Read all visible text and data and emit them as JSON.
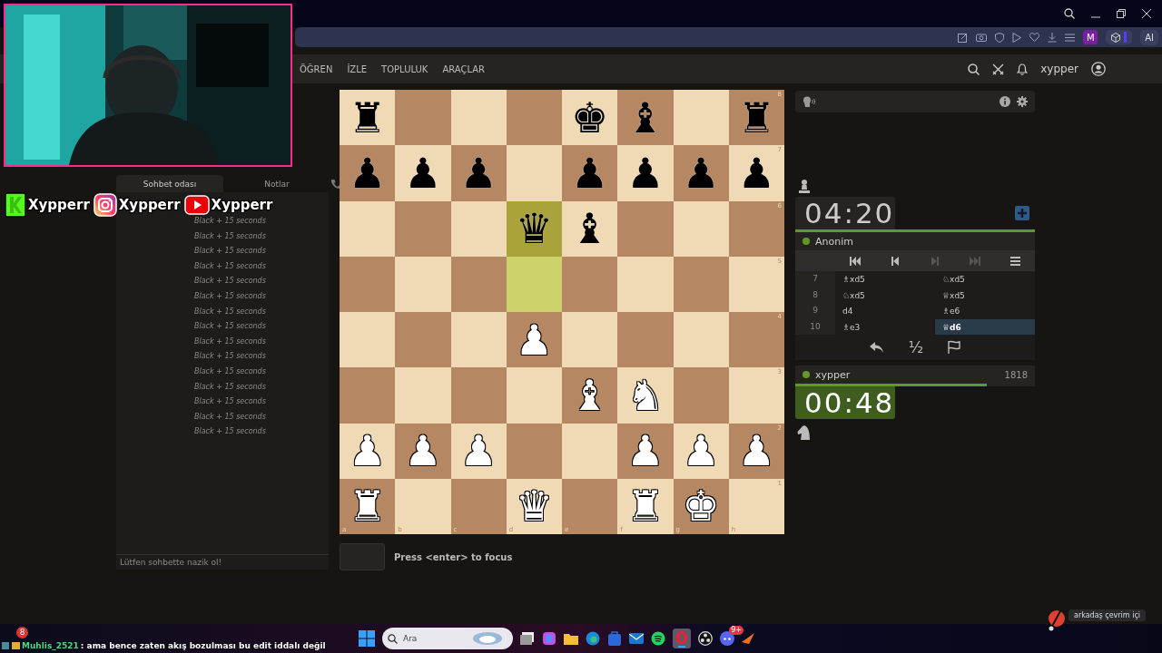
{
  "browser": {
    "profile": "M",
    "ai_button": "AI"
  },
  "site_nav": {
    "items": [
      "ÖĞREN",
      "İZLE",
      "TOPLULUK",
      "ARAÇLAR"
    ],
    "username": "xypper"
  },
  "chat": {
    "tabs": [
      {
        "label": "Sohbet odası",
        "selected": true
      },
      {
        "label": "Notlar",
        "selected": false
      }
    ],
    "messages": [
      "Black + 15 seconds",
      "Black + 15 seconds",
      "Black + 15 seconds",
      "Black + 15 seconds",
      "Black + 15 seconds",
      "Black + 15 seconds",
      "Black + 15 seconds",
      "Black + 15 seconds",
      "Black + 15 seconds",
      "Black + 15 seconds",
      "Black + 15 seconds",
      "Black + 15 seconds",
      "Black + 15 seconds",
      "Black + 15 seconds",
      "Black + 15 seconds"
    ],
    "placeholder": "Lütfen sohbette nazik ol!"
  },
  "stream_overlay": {
    "socials": [
      {
        "kind": "kick",
        "handle": "Xypperr"
      },
      {
        "kind": "instagram",
        "handle": "Xypperr"
      },
      {
        "kind": "youtube",
        "handle": "Xypperr"
      }
    ],
    "chat_line": {
      "badge_count": "8",
      "user": "Muhlis_2521",
      "text": ": ama bence zaten akış bozulması bu edit iddalı değil"
    }
  },
  "board": {
    "files": [
      "a",
      "b",
      "c",
      "d",
      "e",
      "f",
      "g",
      "h"
    ],
    "ranks": [
      {
        "label": "8",
        "squares": [
          {
            "piece": "♜",
            "color": "#000000",
            "highlighted": false
          },
          {
            "highlighted": false
          },
          {
            "highlighted": false
          },
          {
            "highlighted": false
          },
          {
            "piece": "♚",
            "color": "#000000",
            "highlighted": false
          },
          {
            "piece": "♝",
            "color": "#000000",
            "highlighted": false
          },
          {
            "highlighted": false
          },
          {
            "piece": "♜",
            "color": "#000000",
            "highlighted": false
          }
        ]
      },
      {
        "label": "7",
        "squares": [
          {
            "piece": "♟",
            "color": "#000000",
            "highlighted": false
          },
          {
            "piece": "♟",
            "color": "#000000",
            "highlighted": false
          },
          {
            "piece": "♟",
            "color": "#000000",
            "highlighted": false
          },
          {
            "highlighted": false
          },
          {
            "piece": "♟",
            "color": "#000000",
            "highlighted": false
          },
          {
            "piece": "♟",
            "color": "#000000",
            "highlighted": false
          },
          {
            "piece": "♟",
            "color": "#000000",
            "highlighted": false
          },
          {
            "piece": "♟",
            "color": "#000000",
            "highlighted": false
          }
        ]
      },
      {
        "label": "6",
        "squares": [
          {
            "highlighted": false
          },
          {
            "highlighted": false
          },
          {
            "highlighted": false
          },
          {
            "piece": "♛",
            "color": "#000000",
            "highlighted": true
          },
          {
            "piece": "♝",
            "color": "#000000",
            "highlighted": false
          },
          {
            "highlighted": false
          },
          {
            "highlighted": false
          },
          {
            "highlighted": false
          }
        ]
      },
      {
        "label": "5",
        "squares": [
          {
            "highlighted": false
          },
          {
            "highlighted": false
          },
          {
            "highlighted": false
          },
          {
            "highlighted": true
          },
          {
            "highlighted": false
          },
          {
            "highlighted": false
          },
          {
            "highlighted": false
          },
          {
            "highlighted": false
          }
        ]
      },
      {
        "label": "4",
        "squares": [
          {
            "highlighted": false
          },
          {
            "highlighted": false
          },
          {
            "highlighted": false
          },
          {
            "piece": "♟",
            "color": "#ffffff",
            "highlighted": false
          },
          {
            "highlighted": false
          },
          {
            "highlighted": false
          },
          {
            "highlighted": false
          },
          {
            "highlighted": false
          }
        ]
      },
      {
        "label": "3",
        "squares": [
          {
            "highlighted": false
          },
          {
            "highlighted": false
          },
          {
            "highlighted": false
          },
          {
            "highlighted": false
          },
          {
            "piece": "♝",
            "color": "#ffffff",
            "highlighted": false
          },
          {
            "piece": "♞",
            "color": "#ffffff",
            "highlighted": false
          },
          {
            "highlighted": false
          },
          {
            "highlighted": false
          }
        ]
      },
      {
        "label": "2",
        "squares": [
          {
            "piece": "♟",
            "color": "#ffffff",
            "highlighted": false
          },
          {
            "piece": "♟",
            "color": "#ffffff",
            "highlighted": false
          },
          {
            "piece": "♟",
            "color": "#ffffff",
            "highlighted": false
          },
          {
            "highlighted": false
          },
          {
            "highlighted": false
          },
          {
            "piece": "♟",
            "color": "#ffffff",
            "highlighted": false
          },
          {
            "piece": "♟",
            "color": "#ffffff",
            "highlighted": false
          },
          {
            "piece": "♟",
            "color": "#ffffff",
            "highlighted": false
          }
        ]
      },
      {
        "label": "1",
        "squares": [
          {
            "piece": "♜",
            "color": "#ffffff",
            "highlighted": false
          },
          {
            "highlighted": false
          },
          {
            "highlighted": false
          },
          {
            "piece": "♛",
            "color": "#ffffff",
            "highlighted": false
          },
          {
            "highlighted": false
          },
          {
            "piece": "♜",
            "color": "#ffffff",
            "highlighted": false
          },
          {
            "piece": "♚",
            "color": "#ffffff",
            "highlighted": false
          },
          {
            "highlighted": false
          }
        ]
      }
    ]
  },
  "keyboard_move": {
    "hint": "Press <enter> to focus"
  },
  "opponent": {
    "name": "Anonim",
    "online": true,
    "clock": {
      "time": "04:20",
      "running": false
    }
  },
  "nav_controls": [
    {
      "kind": "first",
      "disabled": false
    },
    {
      "kind": "prev",
      "disabled": false
    },
    {
      "kind": "next",
      "disabled": true
    },
    {
      "kind": "last",
      "disabled": true
    },
    {
      "kind": "menu",
      "disabled": false
    }
  ],
  "moves": [
    {
      "number": "7",
      "white": {
        "text": "♗xd5",
        "selected": false
      },
      "black": {
        "text": "♘xd5",
        "selected": false
      }
    },
    {
      "number": "8",
      "white": {
        "text": "♘xd5",
        "selected": false
      },
      "black": {
        "text": "♕xd5",
        "selected": false
      }
    },
    {
      "number": "9",
      "white": {
        "text": "d4",
        "selected": false
      },
      "black": {
        "text": "♗e6",
        "selected": false
      }
    },
    {
      "number": "10",
      "white": {
        "text": "♗e3",
        "selected": false
      },
      "black": {
        "text": "♕d6",
        "selected": true
      }
    }
  ],
  "actions": {
    "draw": "½"
  },
  "player": {
    "name": "xypper",
    "online": true,
    "rating": "1818",
    "level": 0.8,
    "clock": {
      "time": "00:48",
      "running": true
    }
  },
  "taskbar": {
    "search_placeholder": "Ara",
    "discord_badge": "9+",
    "tray_tooltip": "arkadaş çevrim içi"
  }
}
